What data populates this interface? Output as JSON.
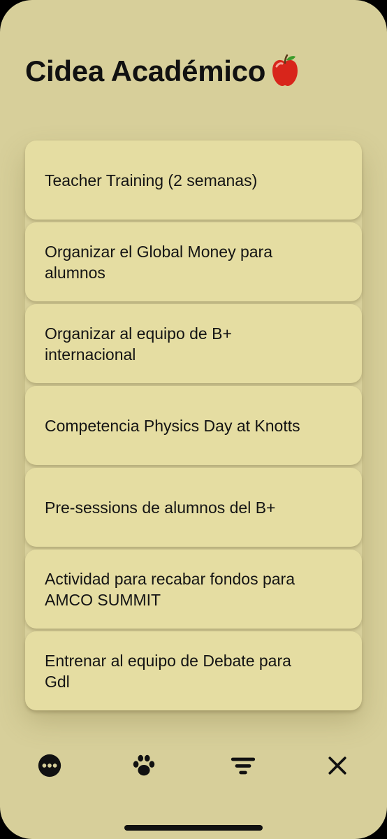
{
  "header": {
    "title": "Cidea Académico"
  },
  "tasks": [
    {
      "label": "Teacher Training (2 semanas)"
    },
    {
      "label": "Organizar el Global Money para alumnos"
    },
    {
      "label": "Organizar al equipo de B+ internacional"
    },
    {
      "label": "Competencia Physics Day at Knotts"
    },
    {
      "label": "Pre-sessions de alumnos del B+"
    },
    {
      "label": "Actividad para recabar fondos para AMCO SUMMIT"
    },
    {
      "label": "Entrenar al equipo de Debate para Gdl"
    }
  ],
  "toolbar": {
    "items": [
      {
        "icon": "more-icon"
      },
      {
        "icon": "paw-icon"
      },
      {
        "icon": "filter-icon"
      },
      {
        "icon": "close-icon"
      }
    ]
  },
  "colors": {
    "background": "#d7cf9a",
    "card": "#e5dda2",
    "text": "#111111"
  }
}
